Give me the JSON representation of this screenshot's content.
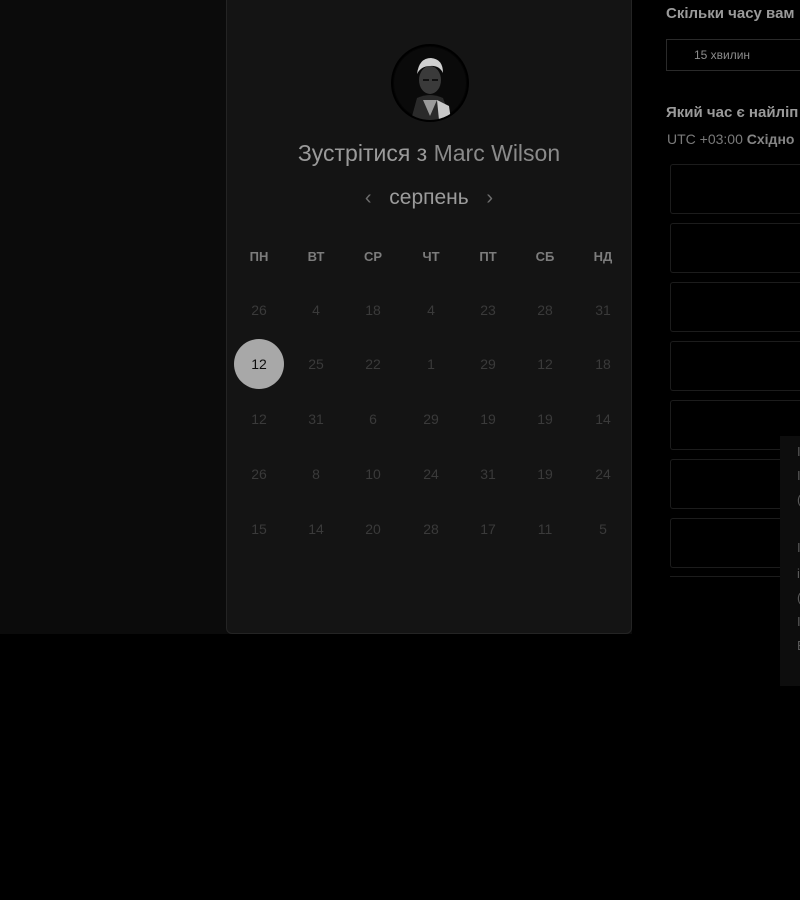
{
  "booking": {
    "title_prefix": "Зустрітися з",
    "host_name": "Marc Wilson",
    "month": "серпень",
    "prev_month_icon": "‹",
    "next_month_icon": "›"
  },
  "calendar": {
    "weekdays": [
      "ПН",
      "ВТ",
      "СР",
      "ЧТ",
      "ПТ",
      "СБ",
      "НД"
    ],
    "selected_day": "12",
    "rows": [
      [
        "26",
        "4",
        "18",
        "4",
        "23",
        "28",
        "31"
      ],
      [
        "12",
        "25",
        "22",
        "1",
        "29",
        "12",
        "18"
      ],
      [
        "12",
        "31",
        "6",
        "29",
        "19",
        "19",
        "14"
      ],
      [
        "26",
        "8",
        "10",
        "24",
        "31",
        "19",
        "24"
      ],
      [
        "15",
        "14",
        "20",
        "28",
        "17",
        "11",
        "5"
      ]
    ]
  },
  "side": {
    "duration_question": "Скільки часу вам",
    "duration_option": "15 хвилин",
    "time_question": "Який час є найліп",
    "timezone_offset": "UTC +03:00",
    "timezone_name": "Східно"
  },
  "colors": {
    "background": "#000000",
    "card": "#141414",
    "selected_day": "#a8a8a8"
  }
}
